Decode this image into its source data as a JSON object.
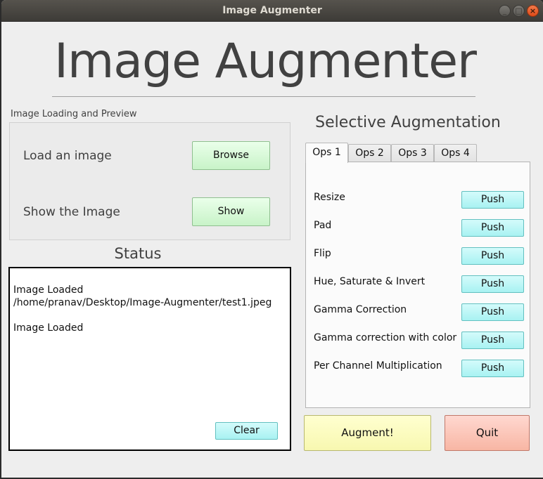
{
  "window": {
    "title": "Image Augmenter",
    "controls": {
      "minimize": "_",
      "maximize": "□",
      "close": "×"
    }
  },
  "header": {
    "title": "Image Augmenter"
  },
  "loading": {
    "group_label": "Image Loading and Preview",
    "rows": [
      {
        "label": "Load an image",
        "button": "Browse"
      },
      {
        "label": "Show the Image",
        "button": "Show"
      }
    ]
  },
  "status": {
    "heading": "Status",
    "text": "Image Loaded\n/home/pranav/Desktop/Image-Augmenter/test1.jpeg\n\nImage Loaded",
    "clear_label": "Clear"
  },
  "augmentation": {
    "heading": "Selective Augmentation",
    "tabs": [
      {
        "label": "Ops 1",
        "active": true
      },
      {
        "label": "Ops 2",
        "active": false
      },
      {
        "label": "Ops 3",
        "active": false
      },
      {
        "label": "Ops 4",
        "active": false
      }
    ],
    "ops": [
      {
        "label": "Resize",
        "button": "Push"
      },
      {
        "label": "Pad",
        "button": "Push"
      },
      {
        "label": "Flip",
        "button": "Push"
      },
      {
        "label": "Hue, Saturate & Invert",
        "button": "Push"
      },
      {
        "label": "Gamma Correction",
        "button": "Push"
      },
      {
        "label": "Gamma correction with color",
        "button": "Push"
      },
      {
        "label": "Per Channel Multiplication",
        "button": "Push"
      }
    ]
  },
  "actions": {
    "augment_label": "Augment!",
    "quit_label": "Quit"
  },
  "colors": {
    "green_button": "#c8f3c8",
    "cyan_button": "#a8f2f2",
    "augment_button": "#f8f8b0",
    "quit_button": "#f8b6a4",
    "close_button": "#df4a18"
  }
}
